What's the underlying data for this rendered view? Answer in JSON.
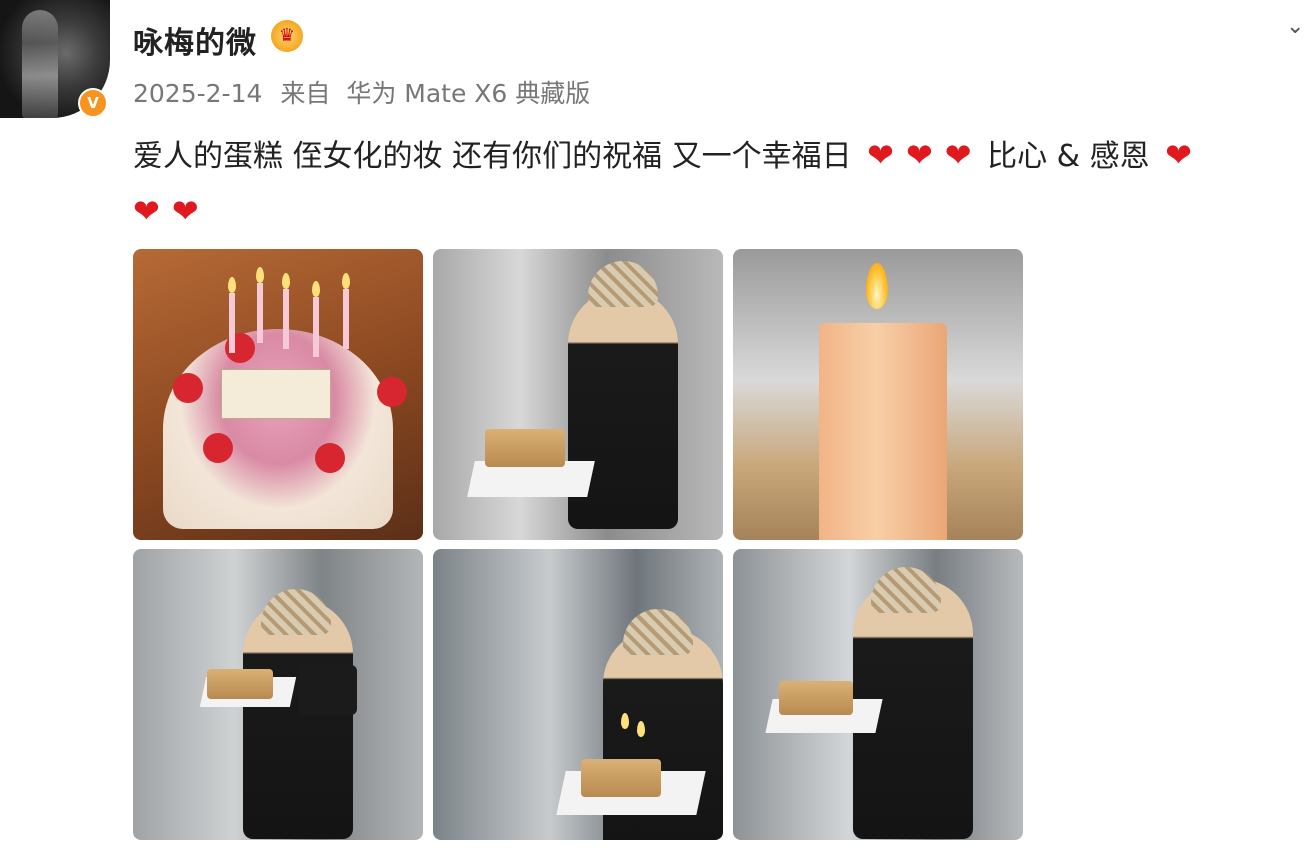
{
  "profile": {
    "username": "咏梅的微",
    "verified_badge": "V",
    "crown_icon": "crown-icon"
  },
  "meta": {
    "date": "2025-2-14",
    "source_prefix": "来自",
    "device": "华为 Mate X6 典藏版"
  },
  "post": {
    "text_main": "爱人的蛋糕 侄女化的妆 还有你们的祝福 又一个幸福日",
    "text_mid": "比心 & 感恩",
    "heart": "❤",
    "heart_color": "#e0191f"
  },
  "colors": {
    "username": "#222222",
    "meta": "#777777",
    "verify_badge": "#f7931e"
  }
}
